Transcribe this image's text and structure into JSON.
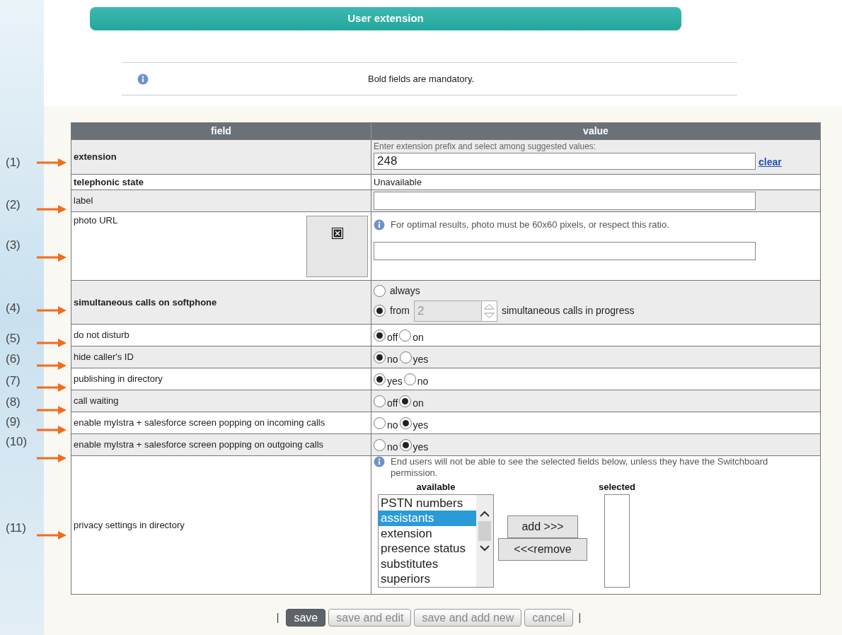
{
  "title": "User extension",
  "notice": "Bold fields are mandatory.",
  "table": {
    "columns": [
      "field",
      "value"
    ],
    "rows": [
      {
        "kind": "extension",
        "label": "extension",
        "mandatory": true,
        "hint": "Enter extension prefix and select among suggested values:",
        "value": "248",
        "link": "clear"
      },
      {
        "kind": "text",
        "label": "telephonic state",
        "mandatory": true,
        "value": "Unavailable"
      },
      {
        "kind": "input",
        "label": "label",
        "mandatory": false
      },
      {
        "kind": "photo",
        "label": "photo URL",
        "mandatory": false,
        "hint": "For optimal results, photo must be 60x60 pixels, or respect this ratio."
      },
      {
        "kind": "simultaneous",
        "label": "simultaneous calls on softphone",
        "mandatory": true,
        "options": [
          {
            "label": "always",
            "selected": false
          },
          {
            "label": "from",
            "selected": true
          }
        ],
        "count": "2",
        "suffix": "simultaneous calls in progress"
      },
      {
        "kind": "radio",
        "label": "do not disturb",
        "mandatory": false,
        "options": [
          {
            "label": "off",
            "selected": true
          },
          {
            "label": "on",
            "selected": false
          }
        ]
      },
      {
        "kind": "radio",
        "label": "hide caller's ID",
        "mandatory": false,
        "options": [
          {
            "label": "no",
            "selected": true
          },
          {
            "label": "yes",
            "selected": false
          }
        ]
      },
      {
        "kind": "radio",
        "label": "publishing in directory",
        "mandatory": false,
        "options": [
          {
            "label": "yes",
            "selected": true
          },
          {
            "label": "no",
            "selected": false
          }
        ]
      },
      {
        "kind": "radio",
        "label": "call waiting",
        "mandatory": false,
        "options": [
          {
            "label": "off",
            "selected": false
          },
          {
            "label": "on",
            "selected": true
          }
        ]
      },
      {
        "kind": "radio",
        "label": "enable myIstra + salesforce screen popping on incoming calls",
        "mandatory": false,
        "options": [
          {
            "label": "no",
            "selected": false
          },
          {
            "label": "yes",
            "selected": true
          }
        ]
      },
      {
        "kind": "radio",
        "label": "enable myIstra + salesforce screen popping on outgoing calls",
        "mandatory": false,
        "options": [
          {
            "label": "no",
            "selected": false
          },
          {
            "label": "yes",
            "selected": true
          }
        ]
      },
      {
        "kind": "privacy",
        "label": "privacy settings in directory",
        "mandatory": false,
        "hint": "End users will not be able to see the selected fields below, unless they have the Switchboard permission.",
        "available_title": "available",
        "selected_title": "selected",
        "available": [
          {
            "label": "PSTN numbers",
            "selected": false
          },
          {
            "label": "assistants",
            "selected": true
          },
          {
            "label": "extension",
            "selected": false
          },
          {
            "label": "presence status",
            "selected": false
          },
          {
            "label": "substitutes",
            "selected": false
          },
          {
            "label": "superiors",
            "selected": false
          }
        ],
        "add": "add >>>",
        "remove": "<<<remove"
      }
    ]
  },
  "buttons": [
    {
      "label": "save",
      "primary": true
    },
    {
      "label": "save and edit",
      "primary": false
    },
    {
      "label": "save and add new",
      "primary": false
    },
    {
      "label": "cancel",
      "primary": false
    }
  ],
  "separators": [
    "|",
    "|"
  ],
  "annotations": [
    "(1)",
    "(2)",
    "(3)",
    "(4)",
    "(5)",
    "(6)",
    "(7)",
    "(8)",
    "(9)",
    "(10)",
    "(11)"
  ]
}
